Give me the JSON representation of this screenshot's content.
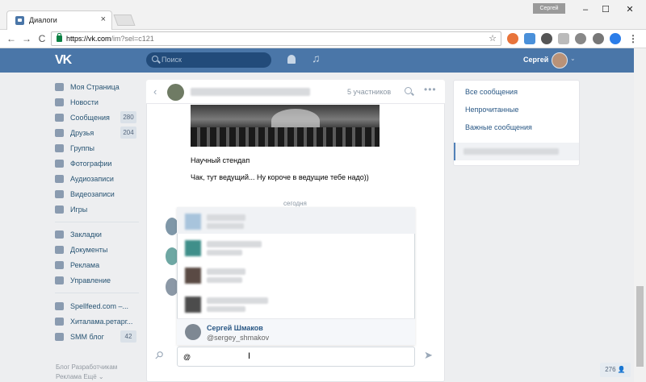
{
  "browser": {
    "tab_title": "Диалоги",
    "tab_close": "×",
    "profile_chip": "Сергей",
    "window_controls": [
      "–",
      "☐",
      "✕"
    ],
    "url_host": "https://vk.com",
    "url_path": "/im?sel=c121",
    "nav": [
      "←",
      "→",
      "C"
    ],
    "bookmark_star": "☆"
  },
  "vk_header": {
    "logo": "VK",
    "search_placeholder": "Поиск",
    "music_icon": "♫",
    "user_name": "Сергей",
    "chevron": "⌄"
  },
  "left_menu": {
    "items": [
      {
        "label": "Моя Страница"
      },
      {
        "label": "Новости"
      },
      {
        "label": "Сообщения",
        "count": "280"
      },
      {
        "label": "Друзья",
        "count": "204"
      },
      {
        "label": "Группы"
      },
      {
        "label": "Фотографии"
      },
      {
        "label": "Аудиозаписи"
      },
      {
        "label": "Видеозаписи"
      },
      {
        "label": "Игры"
      }
    ],
    "items2": [
      {
        "label": "Закладки"
      },
      {
        "label": "Документы"
      },
      {
        "label": "Реклама"
      },
      {
        "label": "Управление"
      }
    ],
    "groups": [
      {
        "label": "Spellfeed.com –..."
      },
      {
        "label": "Хиталама.ретарг..."
      },
      {
        "label": "SMM блог",
        "count": "42"
      }
    ],
    "footer_line1": "Блог   Разработчикам",
    "footer_line2": "Реклама   Ещё ⌄"
  },
  "dialog": {
    "back": "‹",
    "members": "5 участников",
    "more": "•••",
    "messages": [
      "Научный стендап",
      "Чак, тут ведущий... Ну короче в ведущие тебе надо))"
    ],
    "today_label": "сегодня",
    "mention_user": {
      "name": "Сергей Шмаков",
      "handle": "@sergey_shmakov"
    },
    "input_value": "@",
    "cursor": "I",
    "attach_icon": "📎",
    "send_icon": "➤"
  },
  "right_panel": {
    "links": [
      "Все сообщения",
      "Непрочитанные",
      "Важные сообщения"
    ]
  },
  "corner_counter": "276 👤"
}
